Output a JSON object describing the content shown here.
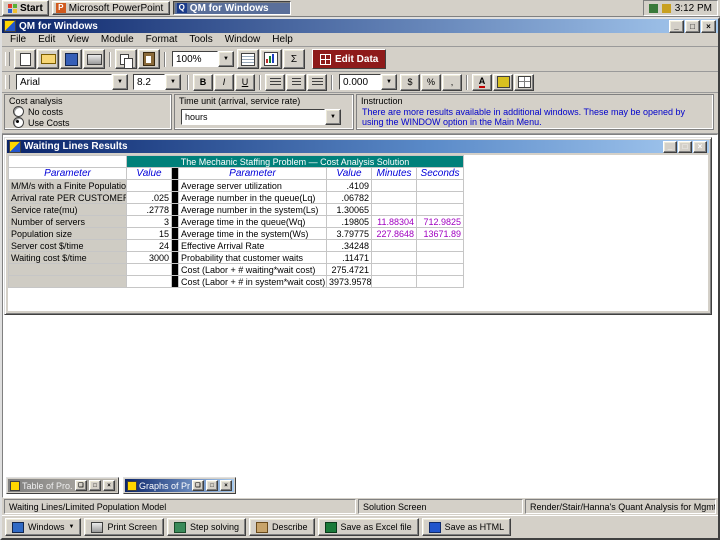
{
  "taskbar": {
    "start_label": "Start",
    "tasks": [
      {
        "label": "Microsoft PowerPoint - [..."
      },
      {
        "label": "QM for Windows"
      }
    ],
    "time": "3:12 PM"
  },
  "app_window": {
    "title": "QM for Windows",
    "menu_items": [
      "File",
      "Edit",
      "View",
      "Module",
      "Format",
      "Tools",
      "Window",
      "Help"
    ],
    "toolbar": {
      "zoom": "100%",
      "edit_data": "Edit Data"
    },
    "format_bar": {
      "font": "Arial",
      "size": "8.2",
      "number_format": "0.000",
      "bold": "B",
      "italic": "I",
      "underline": "U",
      "currency": "$",
      "percent": "%",
      "comma": ",",
      "font_color": "A"
    }
  },
  "options_panel": {
    "cost_analysis": {
      "title": "Cost analysis",
      "options": [
        "No costs",
        "Use Costs"
      ],
      "selected": "Use Costs"
    },
    "time_unit": {
      "title": "Time unit (arrival, service rate)",
      "value": "hours"
    },
    "instruction": {
      "title": "Instruction",
      "text": "There are more results available in additional windows. These may be opened by using the WINDOW option in the Main Menu."
    }
  },
  "results_window": {
    "title": "Waiting Lines Results",
    "caption": "The Mechanic Staffing Problem — Cost Analysis Solution",
    "columns": [
      "Parameter",
      "Value",
      "Parameter",
      "Value",
      "Minutes",
      "Seconds"
    ],
    "rows": [
      [
        "M/M/s with a Finite Population",
        "",
        "Average server utilization",
        ".4109",
        "",
        ""
      ],
      [
        "Arrival rate PER CUSTOMER",
        ".025",
        "Average number in the queue(Lq)",
        ".06782",
        "",
        ""
      ],
      [
        "Service rate(mu)",
        ".2778",
        "Average number in the system(Ls)",
        "1.30065",
        "",
        ""
      ],
      [
        "Number of servers",
        "3",
        "Average time in the queue(Wq)",
        ".19805",
        "11.88304",
        "712.9825"
      ],
      [
        "Population size",
        "15",
        "Average time in the system(Ws)",
        "3.79775",
        "227.8648",
        "13671.89"
      ],
      [
        "Server cost $/time",
        "24",
        "Effective Arrival Rate",
        ".34248",
        "",
        ""
      ],
      [
        "Waiting cost $/time",
        "3000",
        "Probability that customer waits",
        ".11471",
        "",
        ""
      ],
      [
        "",
        "",
        "Cost (Labor + # waiting*wait cost)",
        "275.4721",
        "",
        ""
      ],
      [
        "",
        "",
        "Cost (Labor + # in system*wait cost)",
        "3973.9578",
        "",
        ""
      ]
    ]
  },
  "minimized_windows": [
    {
      "title": "Table of Pro..."
    },
    {
      "title": "Graphs of Pro..."
    }
  ],
  "status_bar": {
    "left": "Waiting Lines/Limited Population Model",
    "center": "Solution Screen",
    "right": "Render/Stair/Hanna's Quant Analysis for Mgmt"
  },
  "bottom_bar": {
    "buttons": [
      {
        "label": "Windows"
      },
      {
        "label": "Print Screen"
      },
      {
        "label": "Step solving"
      },
      {
        "label": "Describe"
      },
      {
        "label": "Save as Excel file"
      },
      {
        "label": "Save as HTML"
      }
    ]
  }
}
